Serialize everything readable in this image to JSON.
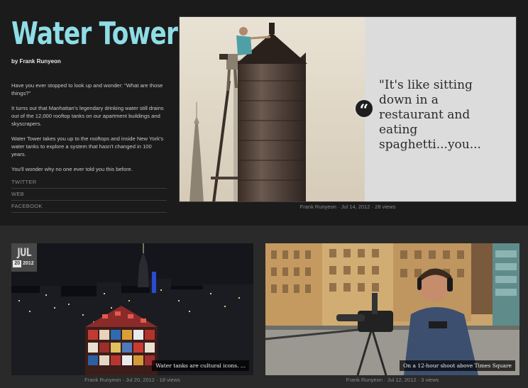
{
  "sidebar": {
    "title": "Water Tower",
    "byline": "by Frank Runyeon",
    "paragraphs": [
      "Have you ever stopped to look up and wonder: \"What are those things?\"",
      "It turns out that Manhattan's legendary drinking water still drains out of the 12,000 rooftop tanks on our apartment buildings and skyscrapers.",
      "Water Tower takes you up to the rooftops and inside New York's water tanks to explore a system that hasn't changed in 100 years.",
      "You'll wonder why no one ever told you this before."
    ],
    "links": [
      "TWITTER",
      "WEB",
      "FACEBOOK"
    ]
  },
  "featured": {
    "quote": "\"It's like sitting down in a restaurant and eating spaghetti...you...",
    "quote_icon": "quote-icon",
    "caption": "Frank Runyeon · Jul 14, 2012 · 28 views"
  },
  "cards": [
    {
      "date_month": "JUL",
      "date_day": "20",
      "date_year": "2012",
      "overlay": "Water tanks are cultural icons. ...",
      "caption": "Frank Runyeon · Jul 20, 2012 · 18 views"
    },
    {
      "overlay": "On a 12-hour shoot above Times Square",
      "caption": "Frank Runyeon · Jul 12, 2012 · 3 views"
    }
  ],
  "colors": {
    "title": "#8fdde6",
    "background": "#1b1b1b",
    "quote_panel": "#dcdcdc"
  }
}
